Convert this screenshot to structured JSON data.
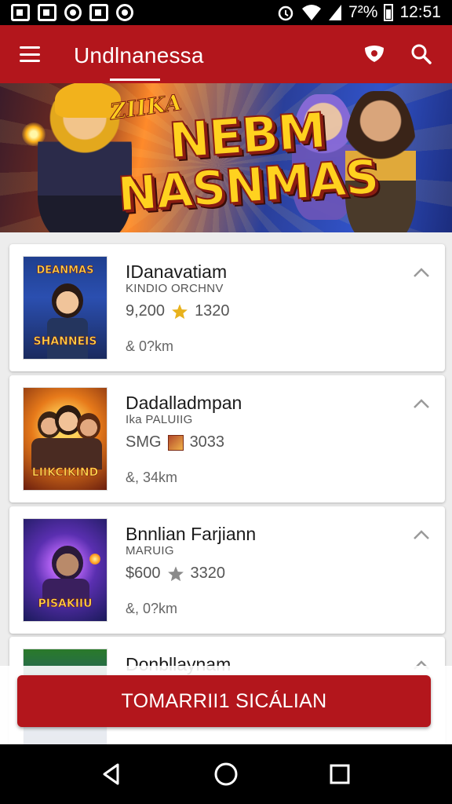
{
  "status_bar": {
    "battery_percent": "7²%",
    "time": "12:51",
    "icons": [
      "chart-notification-icon",
      "pulse-notification-icon",
      "shield-notification-icon",
      "app-notification-icon",
      "circle-notification-icon",
      "alarm-icon",
      "wifi-icon",
      "signal-icon",
      "battery-icon"
    ]
  },
  "app_bar": {
    "title": "Undlnanessa",
    "icons": [
      "menu-icon",
      "shield-icon",
      "search-icon"
    ]
  },
  "banner": {
    "kicker": "ZIIKA",
    "line1": "NEBM",
    "line2": "NASNMAS"
  },
  "cards": [
    {
      "thumb_top": "DEANMAS",
      "thumb_bottom": "SHANNEIS",
      "title": "IDanavatiam",
      "subtitle": "KINDIO ORCHNV",
      "price": "9,200",
      "rating_icon": "star-icon",
      "count": "1320",
      "distance": "& 0?km"
    },
    {
      "thumb_top": "",
      "thumb_bottom": "LIIKCIKIND",
      "title": "Dadalladmpan",
      "subtitle": "Ika PALUIIG",
      "price": "SMG",
      "rating_icon": "game-thumbnail-icon",
      "count": "3033",
      "distance": "&, 34km"
    },
    {
      "thumb_top": "",
      "thumb_bottom": "PISAKIIU",
      "title": "Bnnlian Farjiann",
      "subtitle": "MARUIG",
      "price": "$600",
      "rating_icon": "star-outline-icon",
      "count": "3320",
      "distance": "&, 0?km"
    },
    {
      "title": "Donbllaynam"
    }
  ],
  "cta": {
    "label": "TOMARRII1 SICÁLIAN"
  },
  "nav": {
    "back": "back-icon",
    "home": "home-icon",
    "recents": "recents-icon"
  },
  "colors": {
    "brand": "#b3161c",
    "star": "#e8b21c",
    "text": "#1a1a1a"
  }
}
